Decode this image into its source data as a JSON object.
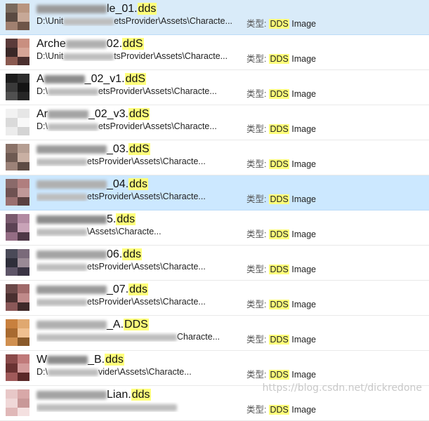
{
  "files": [
    {
      "name_pre": "",
      "name_post": "le_01.",
      "ext": "dds",
      "path_pre": "D:\\Unit",
      "path_post": "etsProvider\\Assets\\Characte...",
      "type_label": "类型:",
      "type_hl": "DDS",
      "type_rest": " Image",
      "selected": true,
      "thumb": [
        "#7a6a5e",
        "#b89580",
        "#5a4a42",
        "#c7a897",
        "#a08070",
        "#6e5548"
      ]
    },
    {
      "name_pre": "Arche",
      "name_post": "02.",
      "ext": "ddS",
      "path_pre": "D:\\Unit",
      "path_post": "tsProvider\\Assets\\Characte...",
      "type_label": "类型:",
      "type_hl": "DDS",
      "type_rest": " Image",
      "selected": false,
      "thumb": [
        "#5b3b3a",
        "#c98f80",
        "#3a2827",
        "#d6a597",
        "#8a5a50",
        "#4a2f2e"
      ]
    },
    {
      "name_pre": "A",
      "name_post": "_02_v1.",
      "ext": "ddS",
      "path_pre": "D:\\",
      "path_post": "etsProvider\\Assets\\Characte...",
      "type_label": "类型:",
      "type_hl": "DDS",
      "type_rest": " Image",
      "selected": false,
      "thumb": [
        "#1c1c1c",
        "#2d2d2d",
        "#3a3a3a",
        "#141414",
        "#505050",
        "#262626"
      ]
    },
    {
      "name_pre": "Ar",
      "name_post": "_02_v3.",
      "ext": "ddS",
      "path_pre": "D:\\",
      "path_post": "etsProvider\\Assets\\Characte...",
      "type_label": "类型:",
      "type_hl": "DDS",
      "type_rest": " Image",
      "selected": false,
      "thumb": [
        "#f2f2f2",
        "#e6e6e6",
        "#dadada",
        "#f8f8f8",
        "#ececec",
        "#d4d4d4"
      ]
    },
    {
      "name_pre": "",
      "name_post": "_03.",
      "ext": "ddS",
      "path_pre": "",
      "path_post": "etsProvider\\Assets\\Characte...",
      "type_label": "类型:",
      "type_hl": "DDS",
      "type_rest": " Image",
      "selected": false,
      "thumb": [
        "#8a7268",
        "#b59e92",
        "#6e5a52",
        "#c9b0a3",
        "#9c8278",
        "#5d4b44"
      ]
    },
    {
      "name_pre": "",
      "name_post": "_04.",
      "ext": "dds",
      "path_pre": "",
      "path_post": "etsProvider\\Assets\\Characte...",
      "type_label": "类型:",
      "type_hl": "DDS",
      "type_rest": " Image",
      "selected": true,
      "thumb": [
        "#8a6a6a",
        "#b07e7e",
        "#6f5252",
        "#c09898",
        "#9a7070",
        "#5a4040"
      ]
    },
    {
      "name_pre": "",
      "name_post": "5.",
      "ext": "dds",
      "path_pre": "",
      "path_post": "\\Assets\\Characte...",
      "type_label": "类型:",
      "type_hl": "DDS",
      "type_rest": " Image",
      "selected": false,
      "thumb": [
        "#7a5a6e",
        "#b28aa2",
        "#5c4254",
        "#c9a3b8",
        "#946d84",
        "#4e3746"
      ]
    },
    {
      "name_pre": "",
      "name_post": "06.",
      "ext": "dds",
      "path_pre": "",
      "path_post": "etsProvider\\Assets\\Characte...",
      "type_label": "类型:",
      "type_hl": "DDS",
      "type_rest": " Image",
      "selected": false,
      "thumb": [
        "#4a4a58",
        "#7a6a7a",
        "#2e2e3a",
        "#9a8a96",
        "#5e5568",
        "#3a3444"
      ]
    },
    {
      "name_pre": "",
      "name_post": "_07.",
      "ext": "dds",
      "path_pre": "",
      "path_post": "etsProvider\\Assets\\Characte...",
      "type_label": "类型:",
      "type_hl": "DDS",
      "type_rest": " Image",
      "selected": false,
      "thumb": [
        "#6a4848",
        "#a06a6a",
        "#4a3030",
        "#c08a8a",
        "#8a5858",
        "#3e2828"
      ]
    },
    {
      "name_pre": "",
      "name_post": "_A.",
      "ext": "DDS",
      "path_pre": "",
      "path_post": "Characte...",
      "type_label": "类型:",
      "type_hl": "DDS",
      "type_rest": " Image",
      "selected": false,
      "thumb": [
        "#c8803e",
        "#e0a870",
        "#a86a30",
        "#f0c090",
        "#d09050",
        "#8a5a2a"
      ]
    },
    {
      "name_pre": "W",
      "name_post": "_B.",
      "ext": "dds",
      "path_pre": "D:\\",
      "path_post": "vider\\Assets\\Characte...",
      "type_label": "类型:",
      "type_hl": "DDS",
      "type_rest": " Image",
      "selected": false,
      "thumb": [
        "#8a4a4a",
        "#c07a7a",
        "#6a3232",
        "#d29a9a",
        "#a05a5a",
        "#5a2828"
      ]
    },
    {
      "name_pre": "",
      "name_post": "Lian.",
      "ext": "dds",
      "path_pre": "",
      "path_post": "",
      "type_label": "类型:",
      "type_hl": "DDS",
      "type_rest": " Image",
      "selected": false,
      "thumb": [
        "#e8c8c8",
        "#d8a8a8",
        "#f0d8d8",
        "#c89898",
        "#e0b8b8",
        "#f4e0e0"
      ]
    }
  ],
  "watermark": "https://blog.csdn.net/dickredone"
}
